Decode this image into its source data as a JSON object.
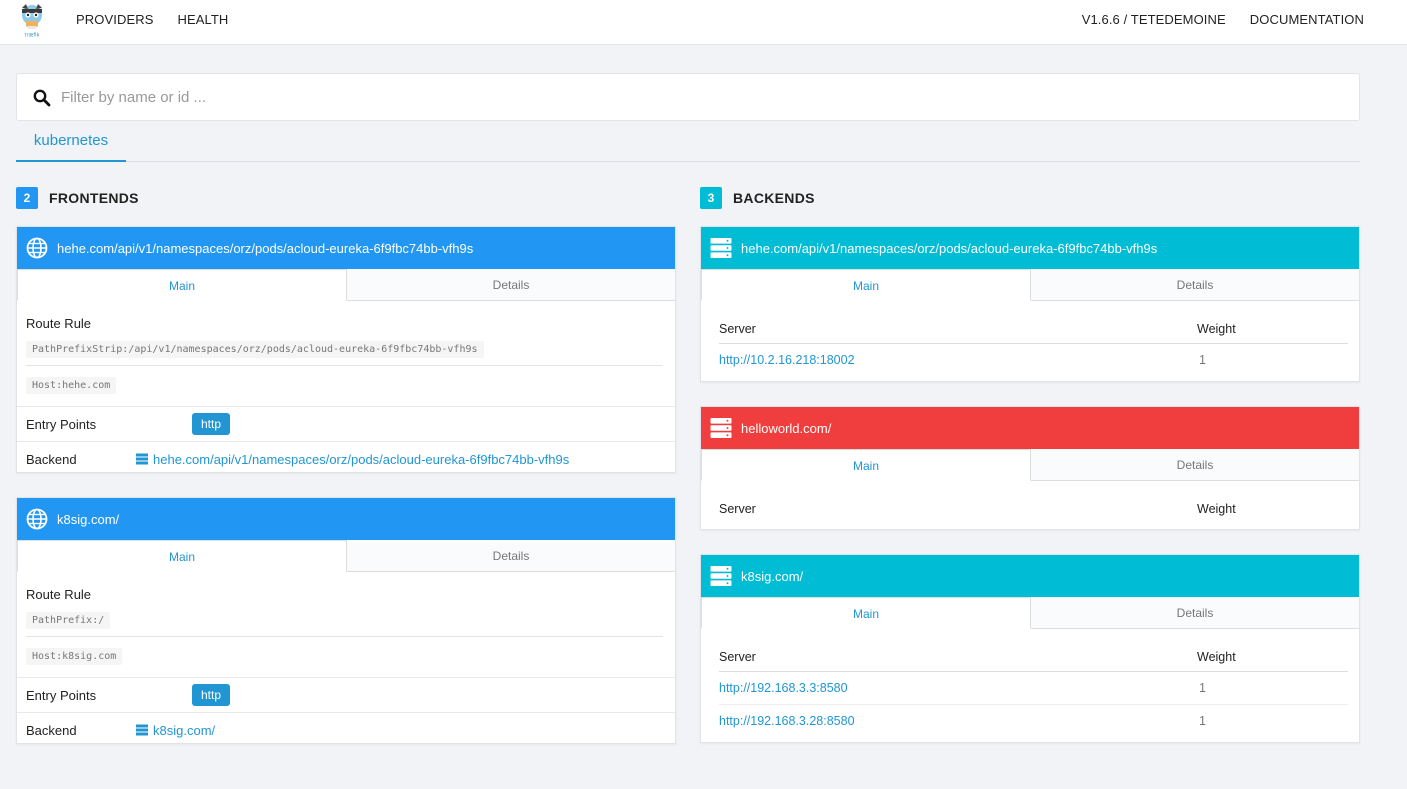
{
  "nav": {
    "left": [
      "PROVIDERS",
      "HEALTH"
    ],
    "right": [
      "V1.6.6 / TETEDEMOINE",
      "DOCUMENTATION"
    ]
  },
  "search": {
    "placeholder": "Filter by name or id ..."
  },
  "provider_tab": "kubernetes",
  "colors": {
    "blue": "#2196f3",
    "cyan": "#00bcd4",
    "red": "#f03e3e",
    "link": "#2196d3"
  },
  "frontends": {
    "count": "2",
    "title": "FRONTENDS",
    "tab_main": "Main",
    "tab_details": "Details",
    "route_rule_label": "Route Rule",
    "entry_points_label": "Entry Points",
    "backend_label": "Backend",
    "items": [
      {
        "name": "hehe.com/api/v1/namespaces/orz/pods/acloud-eureka-6f9fbc74bb-vfh9s",
        "rule1": "PathPrefixStrip:/api/v1/namespaces/orz/pods/acloud-eureka-6f9fbc74bb-vfh9s",
        "rule2": "Host:hehe.com",
        "entry": "http",
        "backend": "hehe.com/api/v1/namespaces/orz/pods/acloud-eureka-6f9fbc74bb-vfh9s"
      },
      {
        "name": "k8sig.com/",
        "rule1": "PathPrefix:/",
        "rule2": "Host:k8sig.com",
        "entry": "http",
        "backend": "k8sig.com/"
      }
    ]
  },
  "backends": {
    "count": "3",
    "title": "BACKENDS",
    "tab_main": "Main",
    "tab_details": "Details",
    "server_label": "Server",
    "weight_label": "Weight",
    "items": [
      {
        "name": "hehe.com/api/v1/namespaces/orz/pods/acloud-eureka-6f9fbc74bb-vfh9s",
        "status": "ok",
        "servers": [
          {
            "url": "http://10.2.16.218:18002",
            "weight": "1"
          }
        ]
      },
      {
        "name": "helloworld.com/",
        "status": "error",
        "servers": []
      },
      {
        "name": "k8sig.com/",
        "status": "ok",
        "servers": [
          {
            "url": "http://192.168.3.3:8580",
            "weight": "1"
          },
          {
            "url": "http://192.168.3.28:8580",
            "weight": "1"
          }
        ]
      }
    ]
  }
}
